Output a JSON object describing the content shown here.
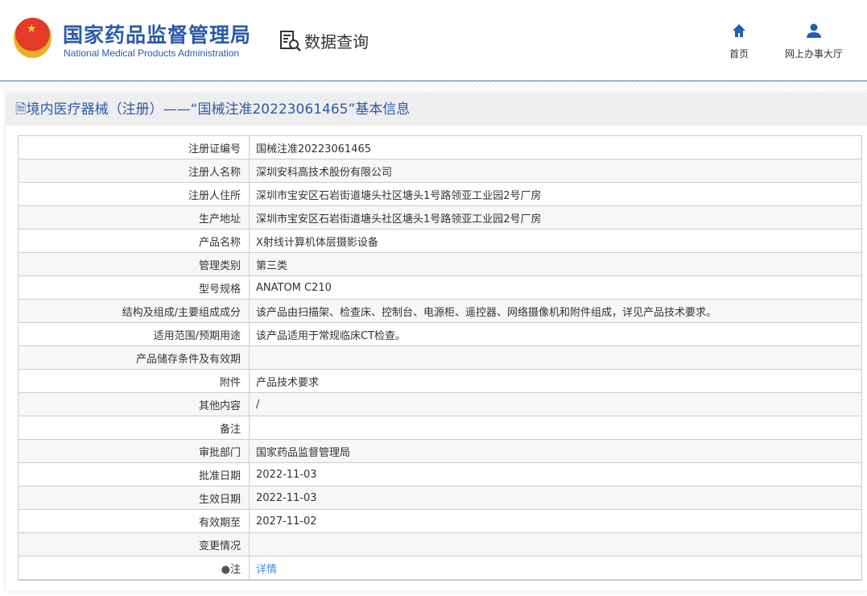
{
  "header": {
    "org_cn": "国家药品监督管理局",
    "org_en": "National Medical Products Administration",
    "section": "数据查询",
    "nav": [
      {
        "label": "首页",
        "icon": "home-icon"
      },
      {
        "label": "网上办事大厅",
        "icon": "user-icon"
      }
    ]
  },
  "page_title": "境内医疗器械（注册）——“国械注准20223061465”基本信息",
  "rows": [
    {
      "label": "注册证编号",
      "value": "国械注准20223061465"
    },
    {
      "label": "注册人名称",
      "value": "深圳安科高技术股份有限公司"
    },
    {
      "label": "注册人住所",
      "value": "深圳市宝安区石岩街道塘头社区塘头1号路领亚工业园2号厂房"
    },
    {
      "label": "生产地址",
      "value": "深圳市宝安区石岩街道塘头社区塘头1号路领亚工业园2号厂房"
    },
    {
      "label": "产品名称",
      "value": "X射线计算机体层摄影设备"
    },
    {
      "label": "管理类别",
      "value": "第三类"
    },
    {
      "label": "型号规格",
      "value": "ANATOM C210"
    },
    {
      "label": "结构及组成/主要组成成分",
      "value": "该产品由扫描架、检查床、控制台、电源柜、遥控器、网络摄像机和附件组成，详见产品技术要求。"
    },
    {
      "label": "适用范围/预期用途",
      "value": "该产品适用于常规临床CT检查。"
    },
    {
      "label": "产品储存条件及有效期",
      "value": ""
    },
    {
      "label": "附件",
      "value": "产品技术要求"
    },
    {
      "label": "其他内容",
      "value": "/"
    },
    {
      "label": "备注",
      "value": ""
    },
    {
      "label": "审批部门",
      "value": "国家药品监督管理局"
    },
    {
      "label": "批准日期",
      "value": "2022-11-03"
    },
    {
      "label": "生效日期",
      "value": "2022-11-03"
    },
    {
      "label": "有效期至",
      "value": "2027-11-02"
    },
    {
      "label": "变更情况",
      "value": ""
    }
  ],
  "note": {
    "label": "注",
    "link": "详情"
  }
}
